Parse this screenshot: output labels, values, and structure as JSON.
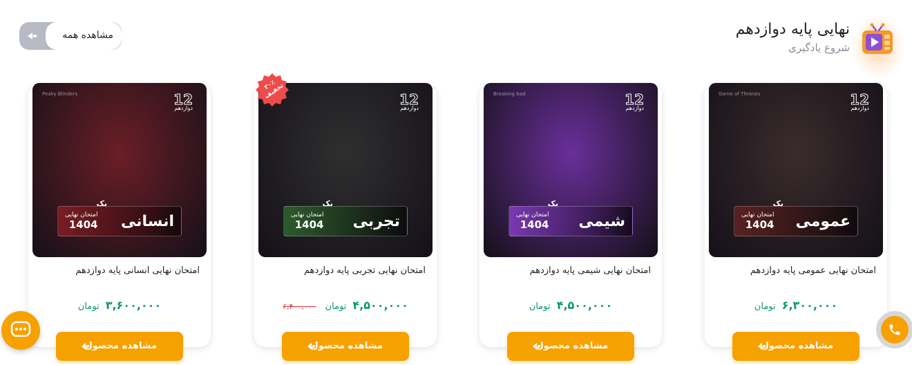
{
  "section": {
    "title": "نهایی پایه دوازدهم",
    "subtitle": "شروع یادگیری",
    "view_all": "مشاهده همه",
    "icon": "tv-play-icon"
  },
  "colors": {
    "accent": "#f7a100",
    "price": "#0e9a63",
    "old_price": "#e53935",
    "badge": "#ee4b4b"
  },
  "products": [
    {
      "title": "امتحان نهایی عمومی پایه دوازدهم",
      "subject": "عمومی",
      "exam": "امتحان نهایی",
      "year": "1404",
      "yak": "یک",
      "grade": "دوازدهم",
      "grade_num": "12",
      "corner": "Game of Thrones",
      "price": "۶,۳۰۰,۰۰۰",
      "old_price": "",
      "currency": "تومان",
      "button": "مشاهده محصول",
      "theme": "#3a2c2c",
      "banner": "#5a2222"
    },
    {
      "title": "امتحان نهایی شیمی پایه دوازدهم",
      "subject": "شیمی",
      "exam": "امتحان نهایی",
      "year": "1404",
      "yak": "یک",
      "grade": "دوازدهم",
      "grade_num": "12",
      "corner": "Breaking bad",
      "price": "۴,۵۰۰,۰۰۰",
      "old_price": "",
      "currency": "تومان",
      "button": "مشاهده محصول",
      "theme": "#6a2f9a",
      "banner": "#7b39b4"
    },
    {
      "title": "امتحان نهایی تجربی پایه دوازدهم",
      "subject": "تجربی",
      "exam": "امتحان نهایی",
      "year": "1404",
      "yak": "یک",
      "grade": "دوازدهم",
      "grade_num": "12",
      "corner": "",
      "price": "۴,۵۰۰,۰۰۰",
      "old_price": "۶,۴۰۰,۰۰۰",
      "currency": "تومان",
      "button": "مشاهده محصول",
      "discount": "۳۰٪\nتخفیف",
      "theme": "#2f2f2f",
      "banner": "#2e5b2e"
    },
    {
      "title": "امتحان نهایی انسانی پایه دوازدهم",
      "subject": "انسانی",
      "exam": "امتحان نهایی",
      "year": "1404",
      "yak": "یک",
      "grade": "دوازدهم",
      "grade_num": "12",
      "corner": "Peaky Blinders",
      "price": "۳,۶۰۰,۰۰۰",
      "old_price": "",
      "currency": "تومان",
      "button": "مشاهده محصول",
      "theme": "#6b1e26",
      "banner": "#7a1d25"
    }
  ],
  "floating": {
    "chat": "chat-icon",
    "phone": "phone-icon"
  }
}
